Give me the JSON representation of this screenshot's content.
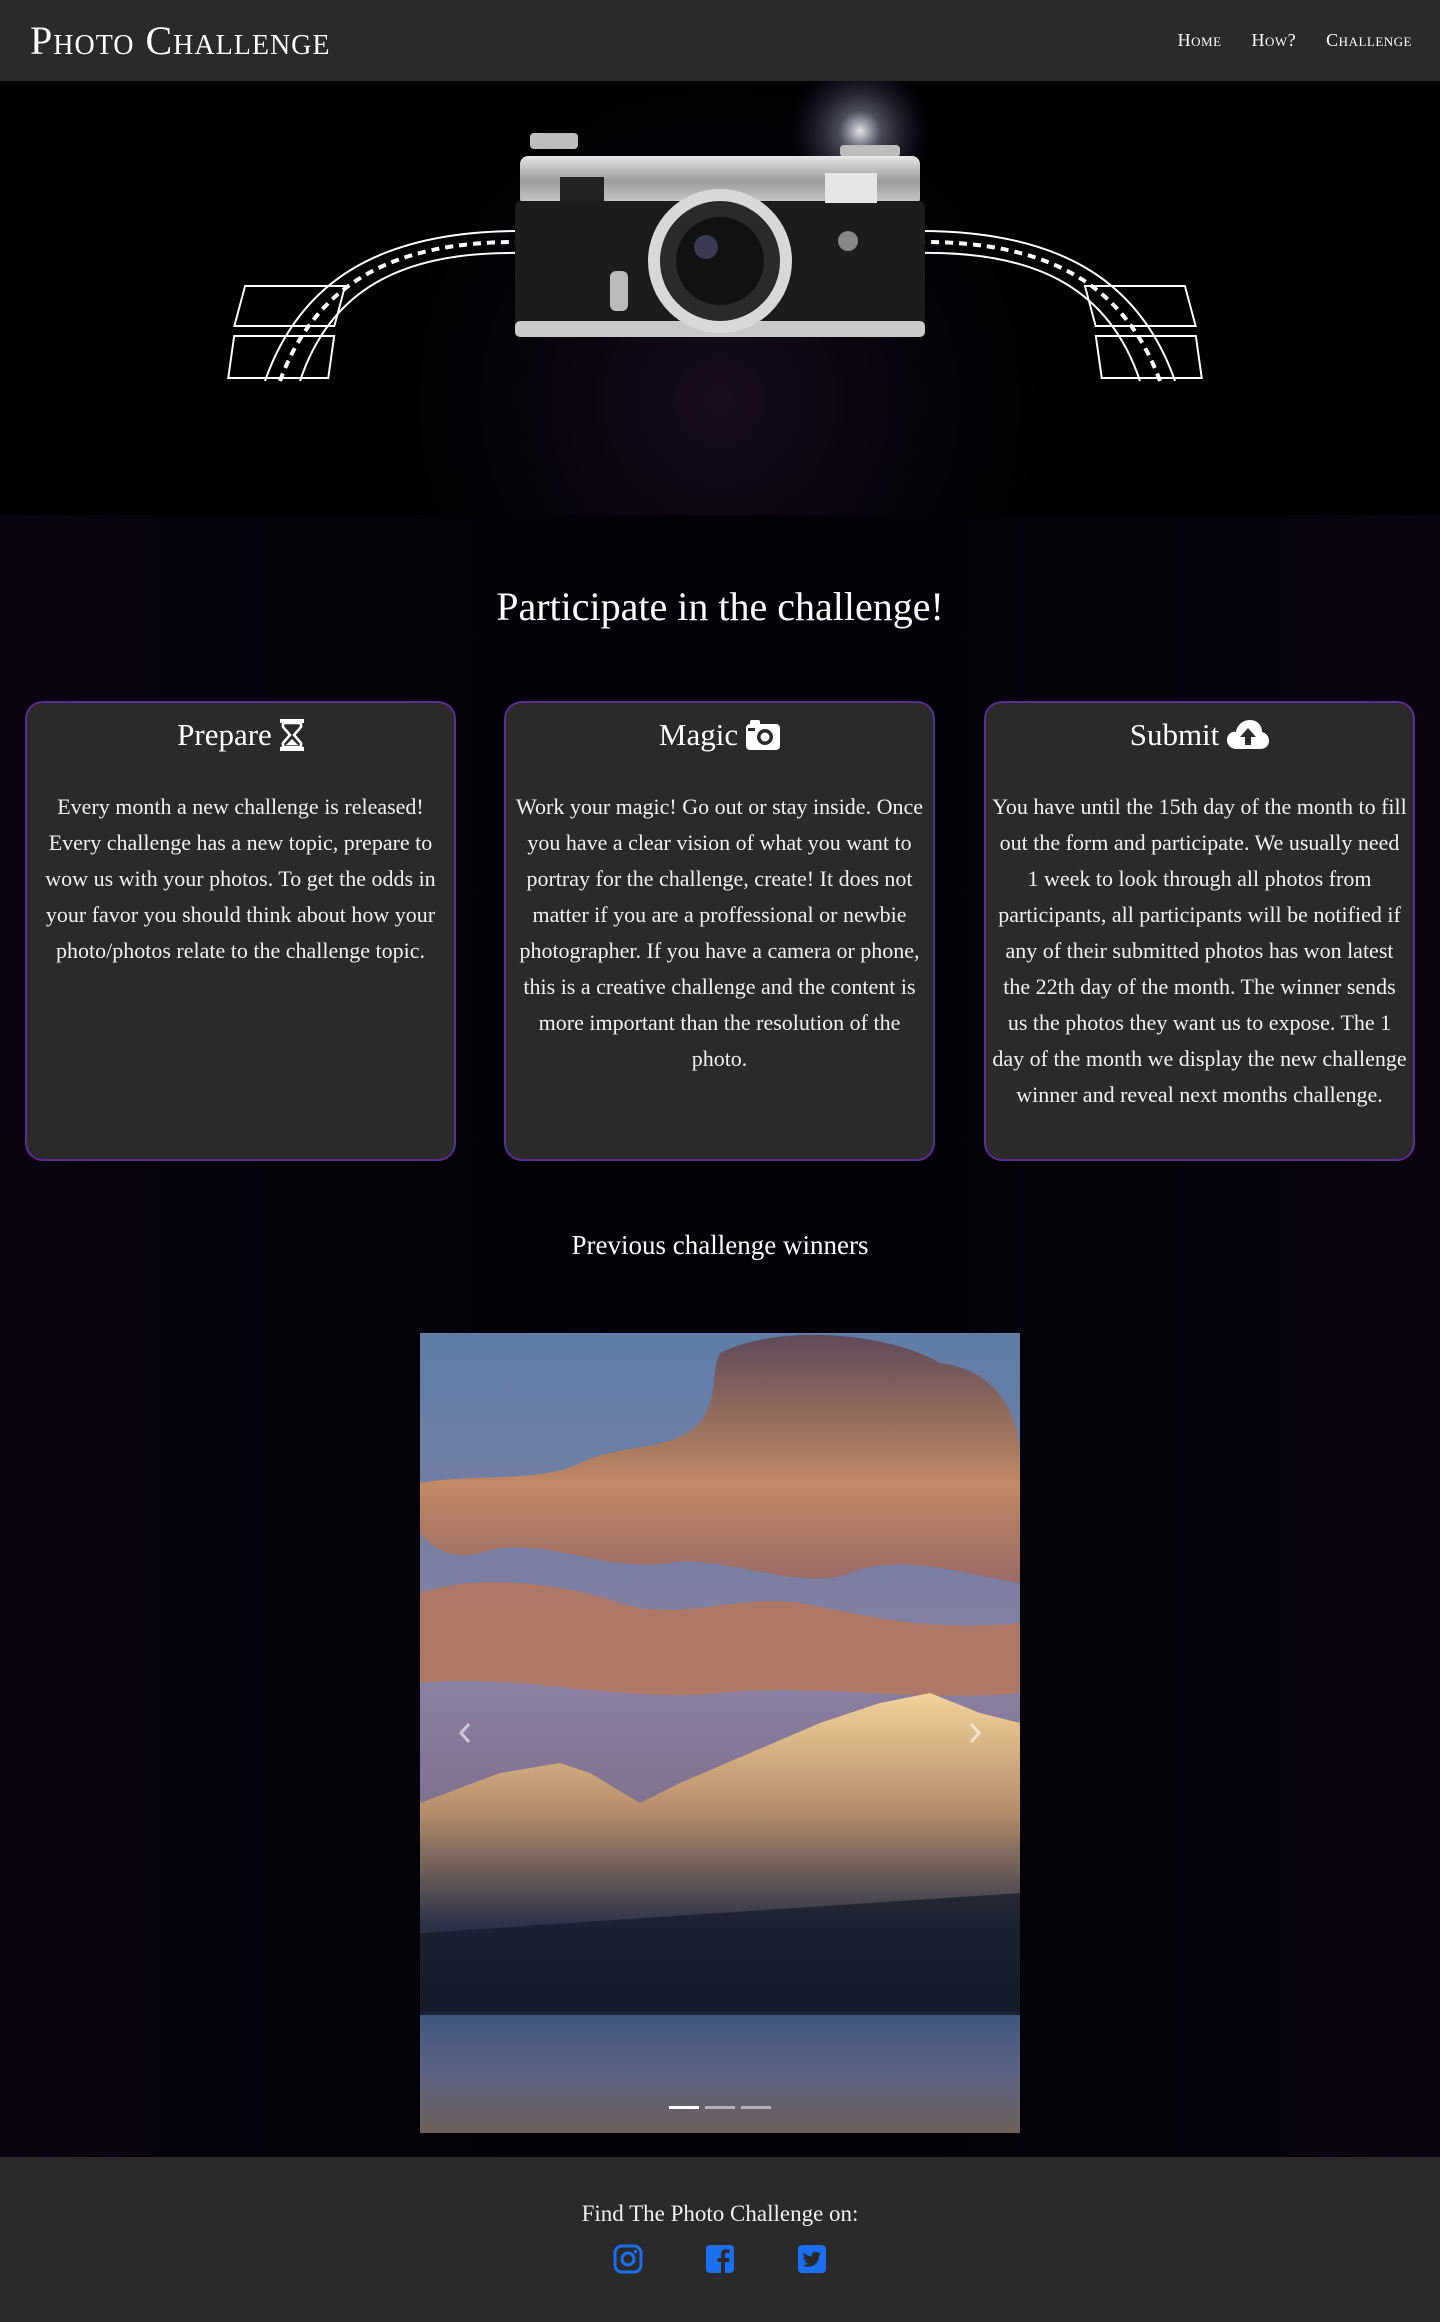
{
  "nav": {
    "brand": "Photo Challenge",
    "links": [
      "Home",
      "How?",
      "Challenge"
    ]
  },
  "participate_title": "Participate in the challenge!",
  "cards": [
    {
      "title": "Prepare",
      "icon": "hourglass-icon",
      "body": "Every month a new challenge is released! Every challenge has a new topic, prepare to wow us with your photos. To get the odds in your favor you should think about how your photo/photos relate to the challenge topic."
    },
    {
      "title": "Magic",
      "icon": "camera-icon",
      "body": "Work your magic! Go out or stay inside. Once you have a clear vision of what you want to portray for the challenge, create! It does not matter if you are a proffessional or newbie photographer. If you have a camera or phone, this is a creative challenge and the content is more important than the resolution of the photo."
    },
    {
      "title": "Submit",
      "icon": "cloud-upload-icon",
      "body": "You have until the 15th day of the month to fill out the form and participate. We usually need 1 week to look through all photos from participants, all participants will be notified if any of their submitted photos has won latest the 22th day of the month. The winner sends us the photos they want us to expose. The 1 day of the month we display the new challenge winner and reveal next months challenge."
    }
  ],
  "winners_title": "Previous challenge winners",
  "carousel": {
    "slides": 3,
    "active": 1
  },
  "footer": {
    "text": "Find The Photo Challenge on:",
    "icons": [
      "instagram-icon",
      "facebook-icon",
      "twitter-icon"
    ],
    "icon_color": "#1a6ff0"
  },
  "colors": {
    "nav_bg": "#2b2a2b",
    "card_border": "#5b2d92",
    "card_bg": "#2b2a2b"
  }
}
